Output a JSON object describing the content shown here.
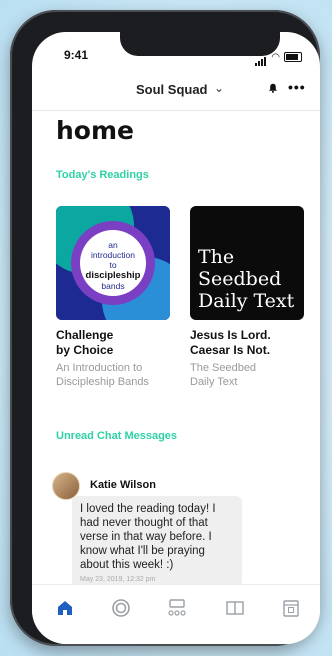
{
  "status_bar": {
    "time": "9:41"
  },
  "header": {
    "group_name": "Soul Squad",
    "chevron_icon": "chevron-down-icon",
    "bell_icon": "bell-icon",
    "more_icon": "more-icon"
  },
  "page_title": "home",
  "todays_readings": {
    "label": "Today's Readings",
    "items": [
      {
        "cover_lines": [
          "an",
          "introduction",
          "to",
          "discipleship",
          "bands"
        ],
        "title_line1": "Challenge",
        "title_line2": "by Choice",
        "subtitle_line1": "An Introduction to",
        "subtitle_line2": "Discipleship Bands"
      },
      {
        "cover_lines": [
          "The",
          "Seedbed",
          "Daily Text"
        ],
        "title_line1": "Jesus Is Lord.",
        "title_line2": "Caesar Is Not.",
        "subtitle_line1": "The Seedbed",
        "subtitle_line2": "Daily Text"
      }
    ]
  },
  "unread_chat": {
    "label": "Unread Chat Messages",
    "message": {
      "author": "Katie Wilson",
      "text_lines": [
        "I loved the reading today! I",
        "had never thought of that",
        "verse in that way before. I",
        "know what I'll be praying",
        "about this week! :)"
      ],
      "timestamp": "May 23, 2019, 12:32 pm"
    }
  },
  "tab_bar": {
    "tabs": [
      {
        "name": "home-tab",
        "icon": "home-icon",
        "active": true
      },
      {
        "name": "circle-tab",
        "icon": "circle-icon",
        "active": false
      },
      {
        "name": "group-tab",
        "icon": "group-icon",
        "active": false
      },
      {
        "name": "reading-tab",
        "icon": "book-icon",
        "active": false
      },
      {
        "name": "calendar-tab",
        "icon": "calendar-icon",
        "active": false
      }
    ]
  },
  "colors": {
    "accent": "#2fd1a5",
    "active_tab": "#1f5fbf",
    "inactive_tab": "#9aa0a6"
  }
}
